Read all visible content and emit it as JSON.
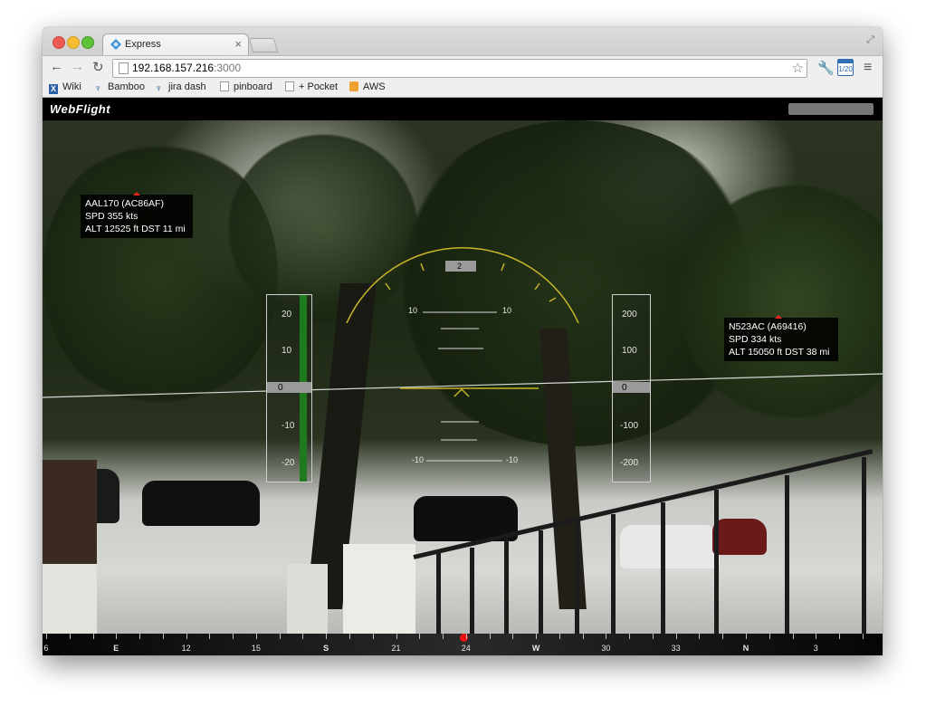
{
  "browser": {
    "tab_title": "Express",
    "tab_close": "×",
    "url_host": "192.168.157.216",
    "url_port": ":3000",
    "calendar_badge": "1/20",
    "bookmarks": [
      {
        "label": "Wiki",
        "icon": "wiki-icon"
      },
      {
        "label": "Bamboo",
        "icon": "bamboo-icon"
      },
      {
        "label": "jira dash",
        "icon": "jira-icon"
      },
      {
        "label": "pinboard",
        "icon": "page-icon"
      },
      {
        "label": "+ Pocket",
        "icon": "page-icon"
      },
      {
        "label": "AWS",
        "icon": "folder-icon"
      }
    ]
  },
  "app": {
    "brand": "WebFlight"
  },
  "flights": [
    {
      "line1": "AAL170  (AC86AF)",
      "line2": "SPD 355 kts",
      "line3": "ALT 12525 ft  DST 11 mi"
    },
    {
      "line1": "N523AC  (A69416)",
      "line2": "SPD 334 kts",
      "line3": "ALT 15050 ft  DST 38 mi"
    }
  ],
  "hud": {
    "speed_tape": {
      "ticks": [
        "20",
        "10",
        "0",
        "-10",
        "-20"
      ],
      "readout": "0"
    },
    "altitude_tape": {
      "ticks": [
        "200",
        "100",
        "0",
        "-100",
        "-200"
      ],
      "readout": "0"
    },
    "pitch_labels": {
      "upper_left": "10",
      "upper_right": "10",
      "lower_left": "-10",
      "lower_right": "-10"
    },
    "roll_readout": "2"
  },
  "heading": {
    "labels": [
      "6",
      "E",
      "12",
      "15",
      "S",
      "21",
      "24",
      "W",
      "30",
      "33",
      "N",
      "3"
    ]
  },
  "colors": {
    "hud_yellow": "#c8b52a",
    "vsi_green": "#1f7a1f",
    "marker_red": "#e11111"
  }
}
